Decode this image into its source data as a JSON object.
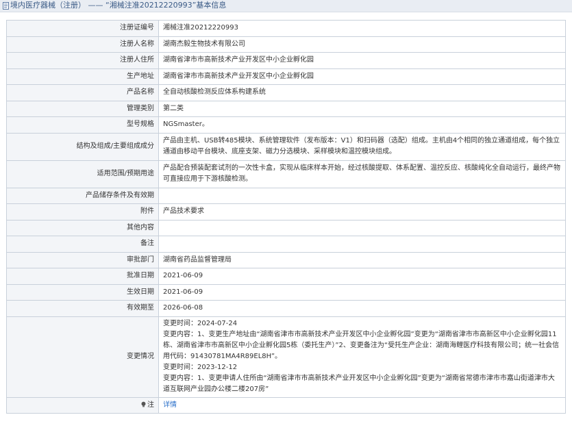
{
  "header": {
    "title": "境内医疗器械（注册） —— “湘械注准20212220993”基本信息"
  },
  "rows": [
    {
      "label": "注册证编号",
      "value": "湘械注准20212220993"
    },
    {
      "label": "注册人名称",
      "value": "湖南杰毅生物技术有限公司"
    },
    {
      "label": "注册人住所",
      "value": "湖南省津市市高新技术产业开发区中小企业孵化园"
    },
    {
      "label": "生产地址",
      "value": "湖南省津市市高新技术产业开发区中小企业孵化园"
    },
    {
      "label": "产品名称",
      "value": "全自动核酸检测反应体系构建系统"
    },
    {
      "label": "管理类别",
      "value": "第二类"
    },
    {
      "label": "型号规格",
      "value": "NGSmaster。"
    },
    {
      "label": "结构及组成/主要组成成分",
      "value": "产品由主机、USB转485模块、系统管理软件（发布版本：V1）和扫码器（选配）组成。主机由4个相同的独立通道组成，每个独立通道由移动平台模块、底座支架、磁力分选模块、采样模块和温控模块组成。"
    },
    {
      "label": "适用范围/预期用途",
      "value": "产品配合预装配套试剂的一次性卡盒，实现从临床样本开始，经过核酸提取、体系配置、温控反应、核酸纯化全自动运行，最终产物可直接应用于下游核酸检测。"
    },
    {
      "label": "产品储存条件及有效期",
      "value": ""
    },
    {
      "label": "附件",
      "value": "产品技术要求"
    },
    {
      "label": "其他内容",
      "value": ""
    },
    {
      "label": "备注",
      "value": ""
    },
    {
      "label": "审批部门",
      "value": "湖南省药品监督管理局"
    },
    {
      "label": "批准日期",
      "value": "2021-06-09"
    },
    {
      "label": "生效日期",
      "value": "2021-06-09"
    },
    {
      "label": "有效期至",
      "value": "2026-06-08"
    }
  ],
  "changes": {
    "label": "变更情况",
    "lines": [
      "变更时间：2024-07-24",
      "变更内容：1、变更生产地址由“湖南省津市市高新技术产业开发区中小企业孵化园”变更为“湖南省津市市高新区中小企业孵化园11栋、湖南省津市市高新区中小企业孵化园5栋（委托生产）”2、变更备注为“受托生产企业：湖南海鲤医疗科技有限公司；统一社会信用代码：91430781MA4R89EL8H”。",
      "变更时间：2023-12-12",
      "变更内容：1、变更申请人住所由“湖南省津市市高新技术产业开发区中小企业孵化园”变更为“湖南省常德市津市市嘉山街道津市大道互联网产业园办公楼二楼207房”"
    ]
  },
  "note": {
    "label": "注",
    "link_text": "详情"
  },
  "icons": {
    "title": "document-icon",
    "note": "bulb-icon"
  },
  "colors": {
    "header_bg": "#e9edf3",
    "header_text": "#3a5a86",
    "label_bg": "#f3f5f8",
    "border": "#c8d0da",
    "link": "#2a6fc9"
  }
}
